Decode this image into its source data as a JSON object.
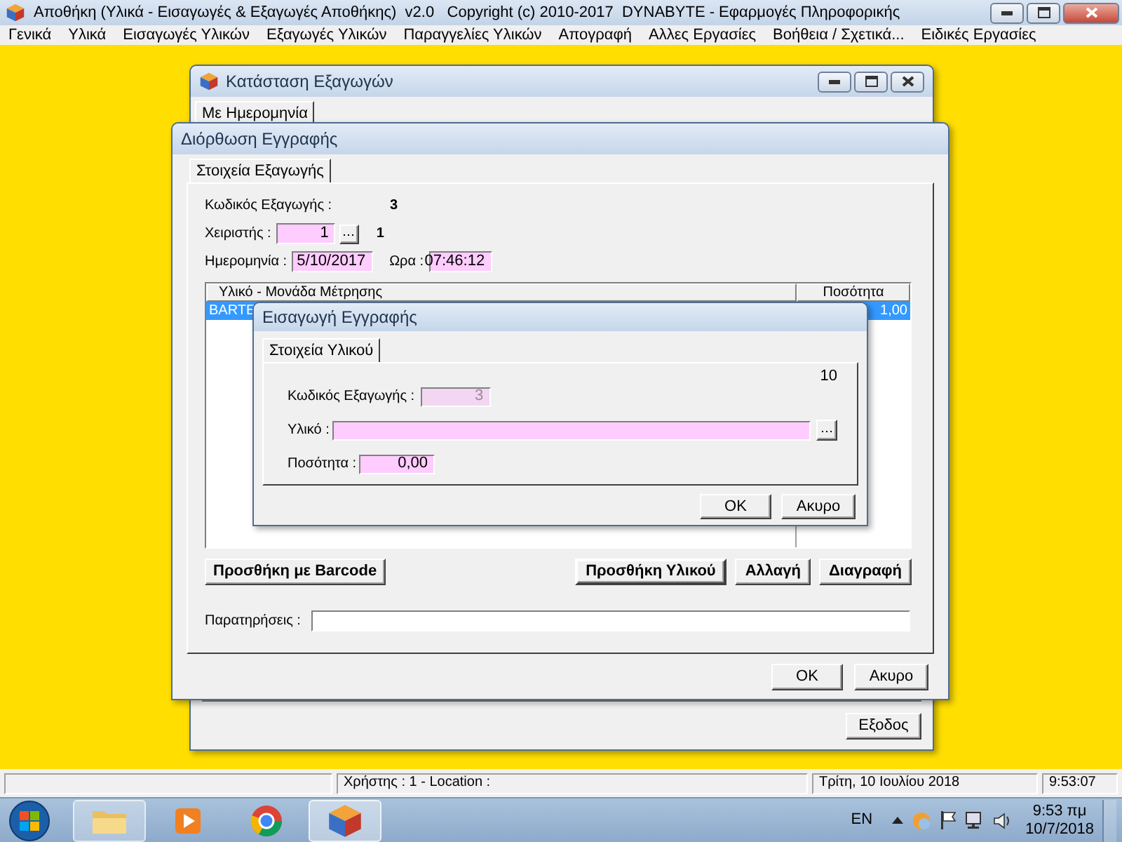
{
  "app": {
    "title": "Αποθήκη (Υλικά - Εισαγωγές & Εξαγωγές Αποθήκης)  v2.0   Copyright (c) 2010-2017  DYNABYTE - Εφαρμογές Πληροφορικής"
  },
  "menu": [
    "Γενικά",
    "Υλικά",
    "Εισαγωγές Υλικών",
    "Εξαγωγές Υλικών",
    "Παραγγελίες Υλικών",
    "Απογραφή",
    "Αλλες Εργασίες",
    "Βοήθεια / Σχετικά...",
    "Ειδικές Εργασίες"
  ],
  "status_window": {
    "title": "Κατάσταση Εξαγωγών",
    "tab": {
      "label": "Με Ημερομηνία",
      "selected": true
    },
    "exit_button": "Εξοδος"
  },
  "edit_window": {
    "title": "Διόρθωση Εγγραφής",
    "tab": {
      "label": "Στοιχεία Εξαγωγής",
      "selected": true
    },
    "code_label": "Κωδικός Εξαγωγής :",
    "code_value": "3",
    "handler_label": "Χειριστής :",
    "handler_value": "1",
    "handler_name": "1",
    "date_label": "Ημερομηνία :",
    "date_value": "5/10/2017",
    "time_label": "Ωρα :",
    "time_value": "07:46:12",
    "table": {
      "columns": [
        "Υλικό - Μονάδα Μέτρησης",
        "Ποσότητα"
      ],
      "rows": [
        {
          "cells": [
            "BARTE",
            "1,00"
          ],
          "selected": true
        }
      ]
    },
    "left_button": "Προσθήκη με Barcode",
    "right_buttons": [
      "Προσθήκη Υλικού",
      "Αλλαγή",
      "Διαγραφή"
    ],
    "notes_label": "Παρατηρήσεις :",
    "ok": "OK",
    "cancel": "Ακυρο"
  },
  "insert_dialog": {
    "title": "Εισαγωγή Εγγραφής",
    "tab": {
      "label": "Στοιχεία Υλικού",
      "selected": true
    },
    "counter": "10",
    "fields": [
      {
        "label": "Κωδικός Εξαγωγής :",
        "value": "3",
        "kind": "short",
        "disabled": true
      },
      {
        "label": "Υλικό :",
        "kind": "lookup",
        "disabled": false
      },
      {
        "label": "Ποσότητα :",
        "value": "0,00",
        "kind": "number",
        "disabled": false
      }
    ],
    "ok": "OK",
    "cancel": "Ακυρο"
  },
  "status_bar": {
    "user": "Χρήστης : 1  -  Location :",
    "date": "Τρίτη, 10 Ιουλίου 2018",
    "time": "9:53:07"
  },
  "taskbar": {
    "language": "EN",
    "time": "9:53 πμ",
    "date": "10/7/2018"
  }
}
